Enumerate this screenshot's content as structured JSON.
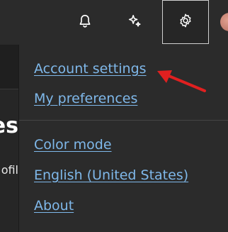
{
  "topbar": {
    "icons": {
      "bell": "bell-icon",
      "copilot": "sparkle-icon",
      "settings": "gear-icon"
    }
  },
  "background": {
    "heading_fragment": "es",
    "text_fragment": "ofil"
  },
  "menu": {
    "items": [
      {
        "label": "Account settings"
      },
      {
        "label": "My preferences"
      },
      {
        "label": "Color mode"
      },
      {
        "label": "English (United States)"
      },
      {
        "label": "About"
      }
    ]
  },
  "colors": {
    "link": "#7fb8ea",
    "annotation_arrow": "#e02020",
    "menu_bg": "#2b2b2b"
  }
}
